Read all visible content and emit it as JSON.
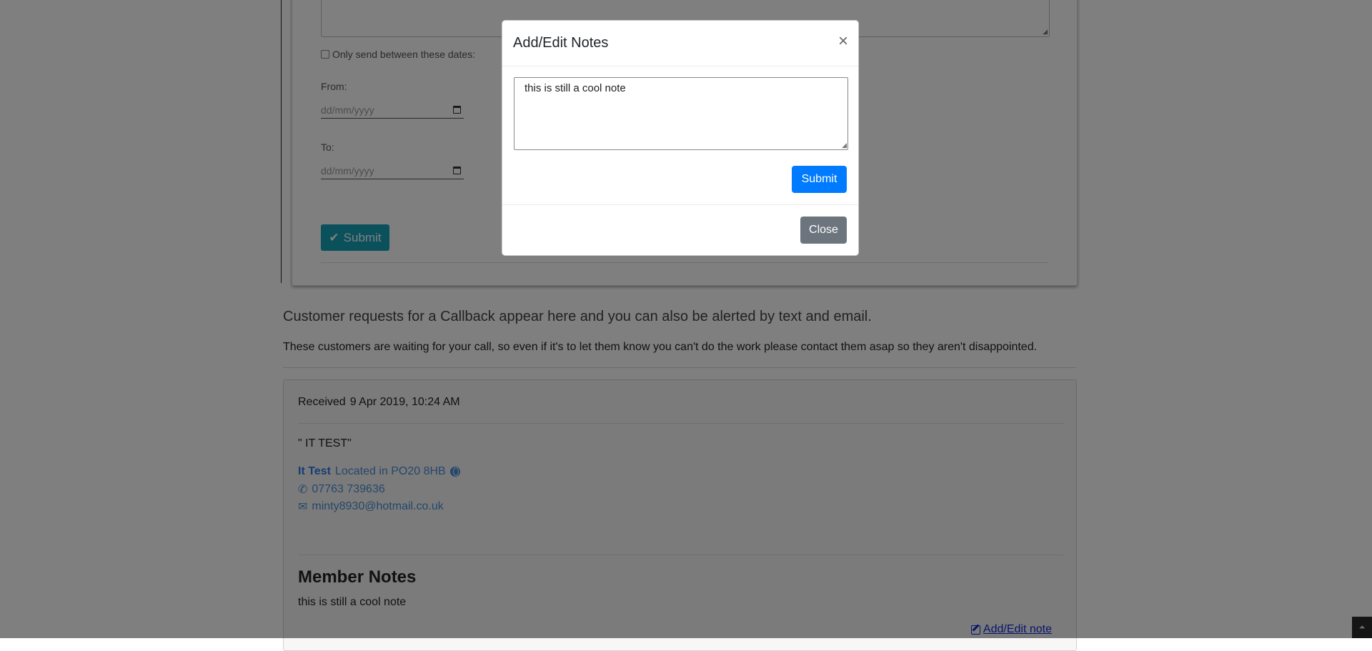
{
  "form": {
    "date_range_checkbox_label": "Only send between these dates:",
    "from_label": "From:",
    "to_label": "To:",
    "date_placeholder": "dd/mm/yyyy",
    "submit_label": "Submit"
  },
  "callbacks": {
    "heading": "Customer requests for a Callback appear here and you can also be alerted by text and email.",
    "info": "These customers are waiting for your call, so even if it's to let them know you can't do the work please contact them asap so they aren't disappointed."
  },
  "lead": {
    "received_label": "Received",
    "received_date": "9 Apr 2019, 10:24 AM",
    "quote": "\" IT TEST\"",
    "name": "It Test",
    "location": "Located in PO20 8HB",
    "phone": "07763 739636",
    "email": "minty8930@hotmail.co.uk",
    "member_notes_heading": "Member Notes",
    "member_notes_text": "this is still a cool note",
    "add_edit_link": "Add/Edit note"
  },
  "modal": {
    "title": "Add/Edit Notes",
    "close_symbol": "×",
    "textarea_value": "this is still a cool note",
    "submit_label": "Submit",
    "close_label": "Close"
  },
  "colors": {
    "primary": "#007bff",
    "secondary": "#6c757d",
    "teal": "#17a2b8",
    "link": "#4a8fd6"
  },
  "icons": {
    "scroll_top": "double-chevron-up-icon"
  }
}
